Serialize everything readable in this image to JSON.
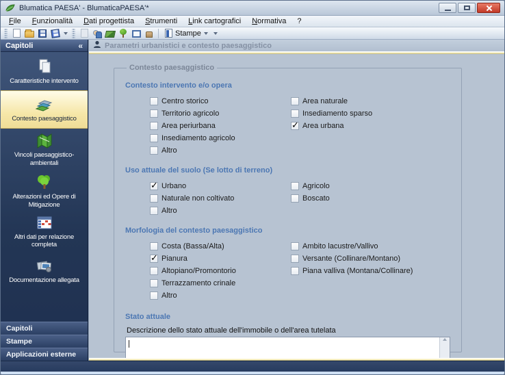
{
  "window": {
    "title": "Blumatica PAESA' - BlumaticaPAESA'*"
  },
  "menu": {
    "items": [
      "File",
      "Funzionalità",
      "Dati progettista",
      "Strumenti",
      "Link cartografici",
      "Normativa",
      "?"
    ]
  },
  "toolbar": {
    "group1_icons": [
      "new-document-icon",
      "open-folder-icon",
      "save-icon",
      "save-all-icon"
    ],
    "group2_icons": [
      "copy-icon",
      "users-icon",
      "map-icon",
      "plant-icon",
      "window-icon",
      "stamp-icon"
    ],
    "stampe_label": "Stampe"
  },
  "sidebar": {
    "header": "Capitoli",
    "collapse_glyph": "«",
    "items": [
      {
        "label": "Caratteristiche intervento",
        "icon": "documents-icon",
        "selected": false
      },
      {
        "label": "Contesto paesaggistico",
        "icon": "map-layers-icon",
        "selected": true
      },
      {
        "label": "Vincoli paesaggistico-ambientali",
        "icon": "green-map-icon",
        "selected": false
      },
      {
        "label": "Alterazioni ed Opere di Mitigazione",
        "icon": "tree-icon",
        "selected": false
      },
      {
        "label": "Altri dati per relazione completa",
        "icon": "table-icon",
        "selected": false
      },
      {
        "label": "Documentazione allegata",
        "icon": "photos-icon",
        "selected": false
      }
    ],
    "bottom_buttons": [
      "Capitoli",
      "Stampe",
      "Applicazioni esterne"
    ]
  },
  "main": {
    "header": "Parametri urbanistici e contesto paesaggistico",
    "groupbox_legend": "Contesto paesaggistico",
    "sections": [
      {
        "title": "Contesto intervento e/o opera",
        "left": [
          {
            "label": "Centro storico",
            "checked": false
          },
          {
            "label": "Territorio agricolo",
            "checked": false
          },
          {
            "label": "Area periurbana",
            "checked": false
          },
          {
            "label": "Insediamento agricolo",
            "checked": false
          },
          {
            "label": "Altro",
            "checked": false
          }
        ],
        "right": [
          {
            "label": "Area naturale",
            "checked": false
          },
          {
            "label": "Insediamento sparso",
            "checked": false
          },
          {
            "label": "Area urbana",
            "checked": true
          }
        ]
      },
      {
        "title": "Uso attuale del suolo (Se lotto di terreno)",
        "left": [
          {
            "label": "Urbano",
            "checked": true
          },
          {
            "label": "Naturale non coltivato",
            "checked": false
          },
          {
            "label": "Altro",
            "checked": false
          }
        ],
        "right": [
          {
            "label": "Agricolo",
            "checked": false
          },
          {
            "label": "Boscato",
            "checked": false
          }
        ]
      },
      {
        "title": "Morfologia del contesto paesaggistico",
        "left": [
          {
            "label": "Costa (Bassa/Alta)",
            "checked": false
          },
          {
            "label": "Pianura",
            "checked": true
          },
          {
            "label": "Altopiano/Promontorio",
            "checked": false
          },
          {
            "label": "Terrazzamento crinale",
            "checked": false
          },
          {
            "label": "Altro",
            "checked": false
          }
        ],
        "right": [
          {
            "label": "Ambito lacustre/Vallivo",
            "checked": false
          },
          {
            "label": "Versante (Collinare/Montano)",
            "checked": false
          },
          {
            "label": "Piana valliva (Montana/Collinare)",
            "checked": false
          }
        ]
      }
    ],
    "stato": {
      "title": "Stato attuale",
      "description_label": "Descrizione dello stato attuale dell'immobile o dell'area tutelata",
      "textarea_value": ""
    }
  },
  "colors": {
    "sidebar_navy": "#2b3f5e",
    "selected_item": "#f6e7a9",
    "accent_line": "#efe6ad",
    "section_heading": "#4c77b3",
    "close_button": "#c23a28"
  }
}
